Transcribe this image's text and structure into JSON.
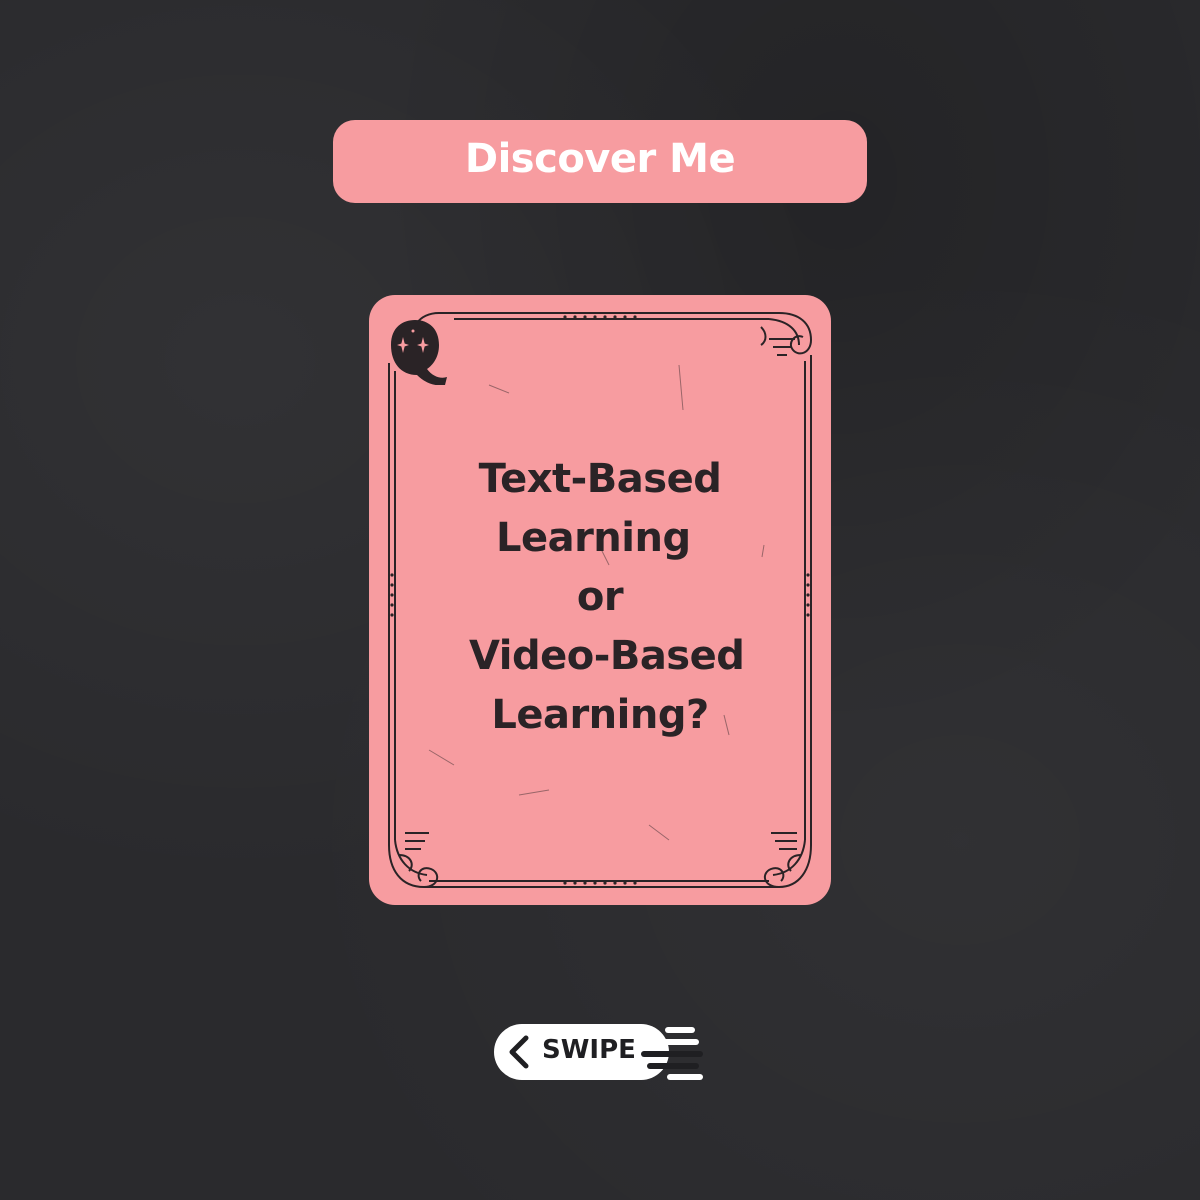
{
  "header": {
    "title": "Discover Me"
  },
  "card": {
    "badge_letter": "Q",
    "question_lines": [
      "Text-Based",
      "Learning ",
      "or",
      " Video-Based",
      "Learning?"
    ]
  },
  "swipe": {
    "label": "SWIPE",
    "icon": "chevron-left-icon",
    "motion_icon": "motion-lines-icon"
  },
  "colors": {
    "background": "#2a2a2d",
    "accent_pink": "#f79ca0",
    "card_ink": "#2a2326",
    "white": "#ffffff"
  }
}
